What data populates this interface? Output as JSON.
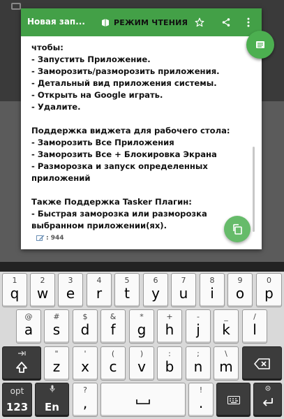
{
  "header": {
    "title": "Новая зап...",
    "read_mode_label": "РЕЖИМ ЧТЕНИЯ",
    "accent_color": "#43a047",
    "icons": [
      "reading-mode-icon",
      "star-icon",
      "share-icon",
      "more-vert-icon"
    ]
  },
  "note": {
    "lines": [
      "чтобы:",
      "- Запустить Приложение.",
      "- Заморозить/разморозить приложения.",
      "- Детальный вид приложения системы.",
      "- Открыть на Google играть.",
      "- Удалите.",
      "",
      "Поддержка виджета для рабочего стола:",
      "- Заморозить Все Приложения",
      "- Заморозить Все + Блокировка Экрана",
      "- Разморозка и запуск определенных",
      "приложений",
      "",
      "Также Поддержка Tasker Плагин:",
      "- Быстрая заморозка или разморозка",
      "выбранном приложении(ях)."
    ],
    "char_count": ": 944"
  },
  "fabs": {
    "top_icon": "book-icon",
    "bottom_icon": "copy-icon"
  },
  "keyboard": {
    "row1": [
      {
        "alt": "1",
        "main": "q"
      },
      {
        "alt": "2",
        "main": "w"
      },
      {
        "alt": "3",
        "main": "e"
      },
      {
        "alt": "4",
        "main": "r"
      },
      {
        "alt": "5",
        "main": "t"
      },
      {
        "alt": "6",
        "main": "y"
      },
      {
        "alt": "7",
        "main": "u"
      },
      {
        "alt": "8",
        "main": "i"
      },
      {
        "alt": "9",
        "main": "o"
      },
      {
        "alt": "0",
        "main": "p"
      }
    ],
    "row2": [
      {
        "alt": "@",
        "main": "a"
      },
      {
        "alt": "#",
        "main": "s"
      },
      {
        "alt": "$",
        "main": "d"
      },
      {
        "alt": "&",
        "main": "f"
      },
      {
        "alt": "*",
        "main": "g"
      },
      {
        "alt": "+",
        "main": "h"
      },
      {
        "alt": "-",
        "main": "j"
      },
      {
        "alt": "_",
        "main": "k"
      },
      {
        "alt": "/",
        "main": "l"
      }
    ],
    "row3": [
      {
        "alt": "\"",
        "main": "z"
      },
      {
        "alt": "'",
        "main": "x"
      },
      {
        "alt": "(",
        "main": "c"
      },
      {
        "alt": ")",
        "main": "v"
      },
      {
        "alt": ":",
        "main": "b"
      },
      {
        "alt": ";",
        "main": "n"
      },
      {
        "alt": "\\",
        "main": "m"
      }
    ],
    "row4": {
      "opt_alt": "opt",
      "opt_main": "123",
      "lang_main": "En",
      "comma_alt": "?",
      "comma_main": ",",
      "period_alt": "!",
      "period_main": "."
    }
  }
}
